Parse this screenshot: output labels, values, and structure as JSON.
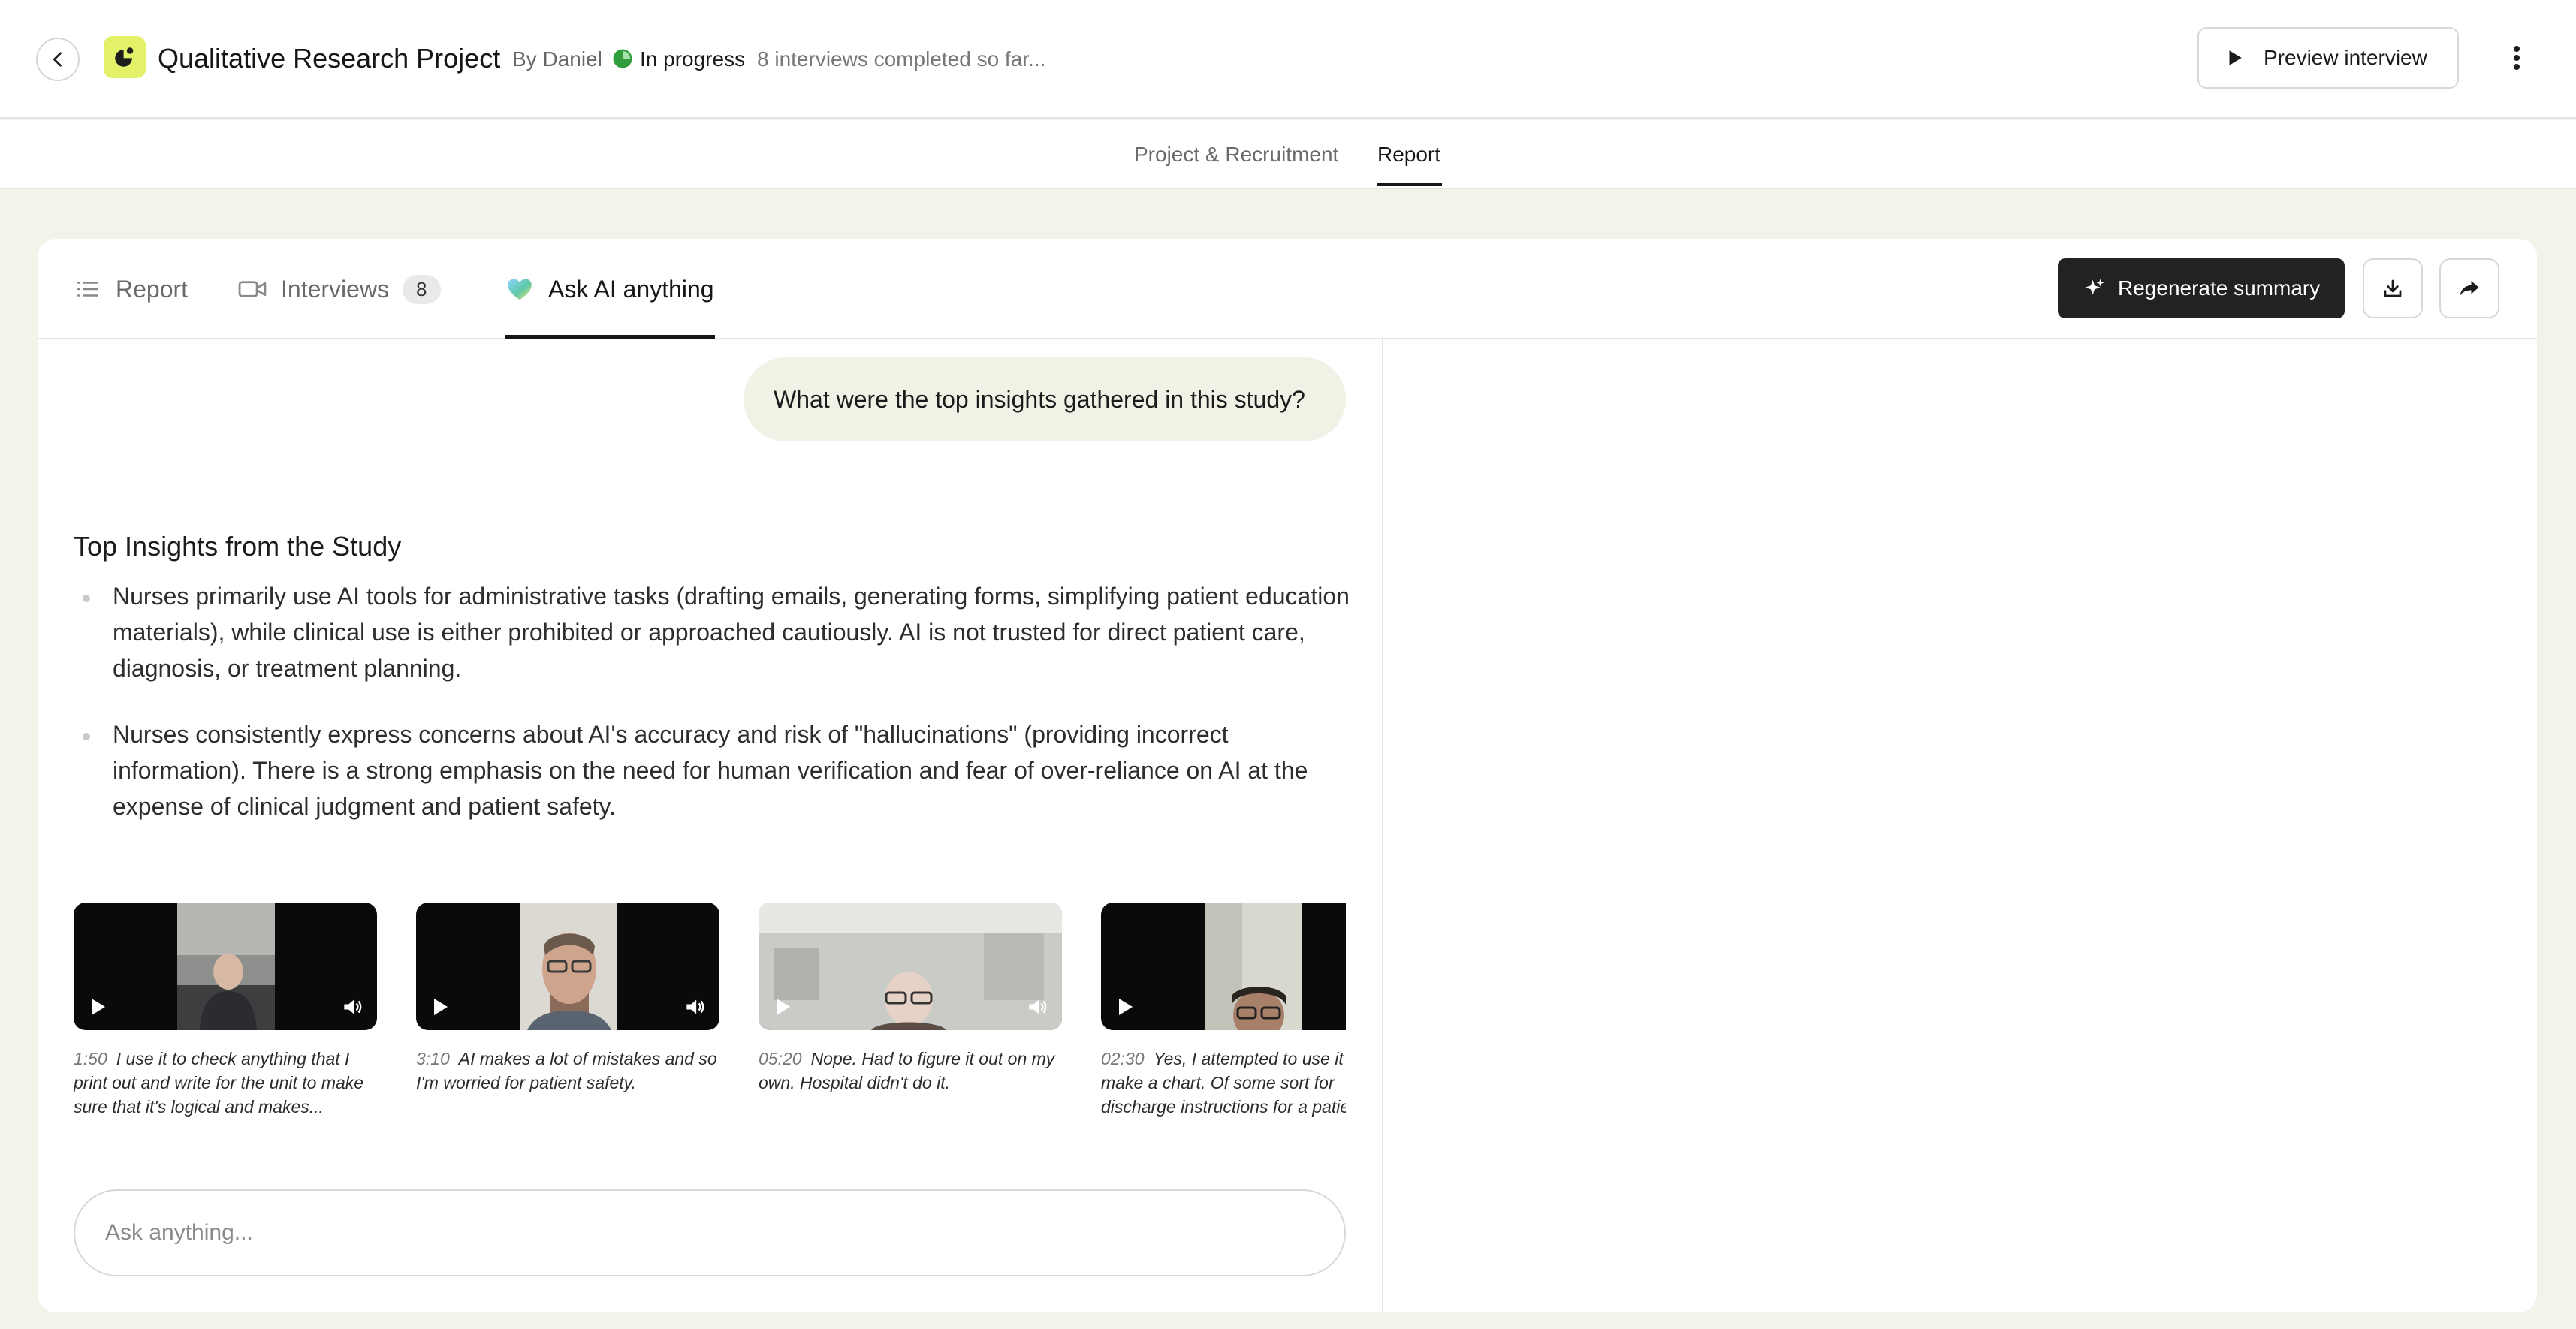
{
  "header": {
    "title": "Qualitative Research Project",
    "by": "By Daniel",
    "status": "In progress",
    "interviews_note": "8 interviews completed so far...",
    "preview_label": "Preview interview"
  },
  "subnav": {
    "tabs": [
      {
        "label": "Project & Recruitment",
        "active": false
      },
      {
        "label": "Report",
        "active": true
      }
    ]
  },
  "card_tabs": {
    "report": "Report",
    "interviews": "Interviews",
    "interviews_count": "8",
    "ask_ai": "Ask AI anything"
  },
  "actions": {
    "regenerate_label": "Regenerate summary"
  },
  "chat": {
    "question": "What were the top insights gathered in this study?",
    "answer_title": "Top Insights from the Study",
    "insights": [
      "Nurses primarily use AI tools for administrative tasks (drafting emails, generating forms, simplifying patient education materials), while clinical use is either prohibited or approached cautiously. AI is not trusted for direct patient care, diagnosis, or treatment planning.",
      "Nurses consistently express concerns about AI's accuracy and risk of \"hallucinations\" (providing incorrect information). There is a strong emphasis on the need for human verification and fear of over-reliance on AI at the expense of clinical judgment and patient safety."
    ],
    "clips": [
      {
        "time": "1:50",
        "quote": "I use it to check anything that I print out and write for the unit to make sure that it's logical and makes..."
      },
      {
        "time": "3:10",
        "quote": "AI makes a lot of mistakes and so I'm worried for patient safety."
      },
      {
        "time": "05:20",
        "quote": "Nope. Had to figure it out on my own. Hospital didn't do it."
      },
      {
        "time": "02:30",
        "quote": "Yes, I attempted to use it to make a chart. Of some sort for discharge instructions for a patient"
      }
    ],
    "input_placeholder": "Ask anything..."
  },
  "colors": {
    "page_bg": "#f3f3e9",
    "accent_logo": "#e3f169",
    "status_green": "#2e9d3a",
    "primary_button": "#222222"
  }
}
